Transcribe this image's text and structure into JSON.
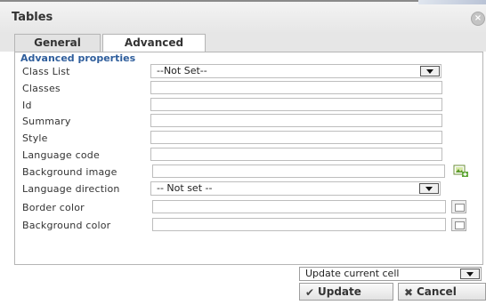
{
  "dialog": {
    "title": "Tables"
  },
  "tabs": [
    {
      "label": "General"
    },
    {
      "label": "Advanced"
    }
  ],
  "section_title": "Advanced properties",
  "fields": {
    "class_list": {
      "label": "Class List",
      "value": "--Not Set--"
    },
    "classes": {
      "label": "Classes",
      "value": ""
    },
    "id": {
      "label": "Id",
      "value": ""
    },
    "summary": {
      "label": "Summary",
      "value": ""
    },
    "style": {
      "label": "Style",
      "value": ""
    },
    "language_code": {
      "label": "Language code",
      "value": ""
    },
    "background_image": {
      "label": "Background image",
      "value": ""
    },
    "language_direction": {
      "label": "Language direction",
      "value": "-- Not set --"
    },
    "border_color": {
      "label": "Border color",
      "value": ""
    },
    "background_color": {
      "label": "Background color",
      "value": ""
    }
  },
  "footer": {
    "scope_select": "Update current cell",
    "update_label": "Update",
    "cancel_label": "Cancel"
  },
  "icons": {
    "close": "close-icon",
    "update": "checkmark-icon",
    "cancel": "x-icon",
    "browse_image": "image-browse-icon",
    "color_picker": "color-picker-icon"
  },
  "colors": {
    "section_title": "#2f5e9c",
    "tab_active": "#ffffff"
  }
}
